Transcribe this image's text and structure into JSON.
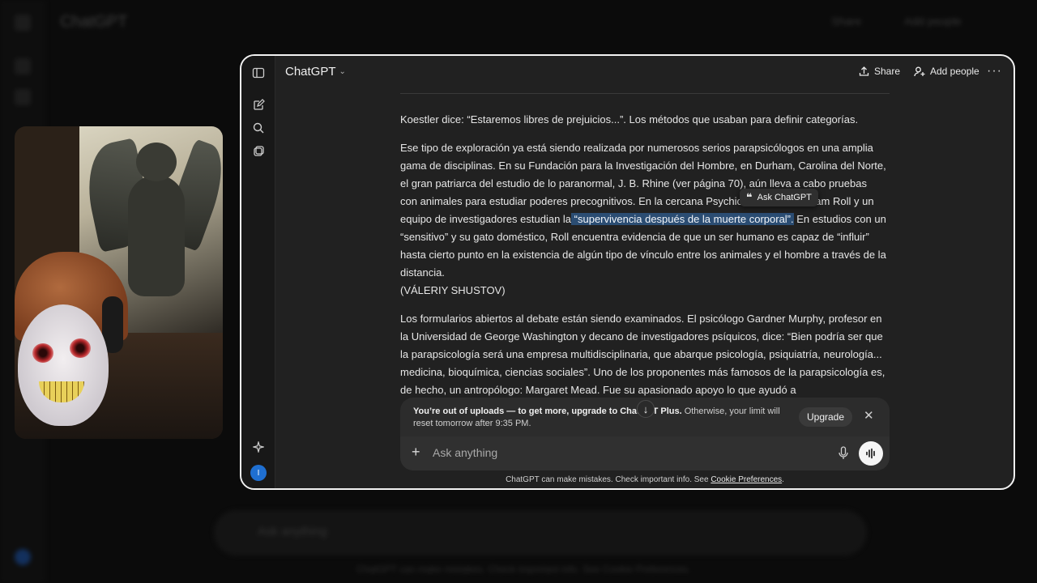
{
  "app": {
    "title": "ChatGPT",
    "share_label": "Share",
    "add_people_label": "Add people"
  },
  "content": {
    "paragraphs": {
      "p0": "Koestler dice: “Estaremos libres de prejuicios...”. Los métodos que usaban para definir categorías.",
      "p1_before": "Ese tipo de exploración ya está siendo realizada por numerosos serios parapsicólogos en una amplia gama de disciplinas. En su Fundación para la Investigación del Hombre, en Durham, Carolina del Norte, el gran patriarca del estudio de lo paranormal, J. B. Rhine (ver página 70), aún lleva a cabo pruebas con animales para estudiar poderes precognitivos. En la cercana Psychic Research, William Roll y un equipo de investigadores estudian la",
      "p1_highlight": " “supervivencia después de la muerte corporal”.",
      "p1_after": " En estudios con un “sensitivo” y su gato doméstico, Roll encuentra evidencia de que un ser humano es capaz de “influir” hasta cierto punto en la existencia de algún tipo de vínculo entre los animales y el hombre a través de la distancia.",
      "p1_author": "(VÁLERIY SHUSTOV)",
      "p2": "Los formularios abiertos al debate están siendo examinados. El psicólogo Gardner Murphy, profesor en la Universidad de George Washington y decano de investigadores psíquicos, dice: “Bien podría ser que la parapsicología será una empresa multidisciplinaria, que abarque psicología, psiquiatría, neurología... medicina, bioquímica, ciencias sociales”. Uno de los proponentes más famosos de la parapsicología es, de hecho, un antropólogo: Margaret Mead. Fue su apasionado apoyo lo que ayudó a"
    },
    "ask_chatgpt_label": "Ask ChatGPT"
  },
  "notice": {
    "bold": "You’re out of uploads — to get more, upgrade to ChatGPT Plus.",
    "rest": " Otherwise, your limit will reset tomorrow after 9:35 PM.",
    "upgrade_label": "Upgrade"
  },
  "composer": {
    "placeholder": "Ask anything"
  },
  "footer": {
    "text": "ChatGPT can make mistakes. Check important info. See ",
    "link": "Cookie Preferences",
    "end": "."
  },
  "user": {
    "avatar_initial": "I"
  },
  "background": {
    "title": "ChatGPT",
    "share": "Share",
    "add_people": "Add people",
    "input_placeholder": "Ask anything",
    "footer": "ChatGPT can make mistakes. Check important info. See Cookie Preferences."
  },
  "colors": {
    "highlight": "#2b4d73",
    "window_bg": "#212121",
    "avatar": "#1f6fd1"
  }
}
